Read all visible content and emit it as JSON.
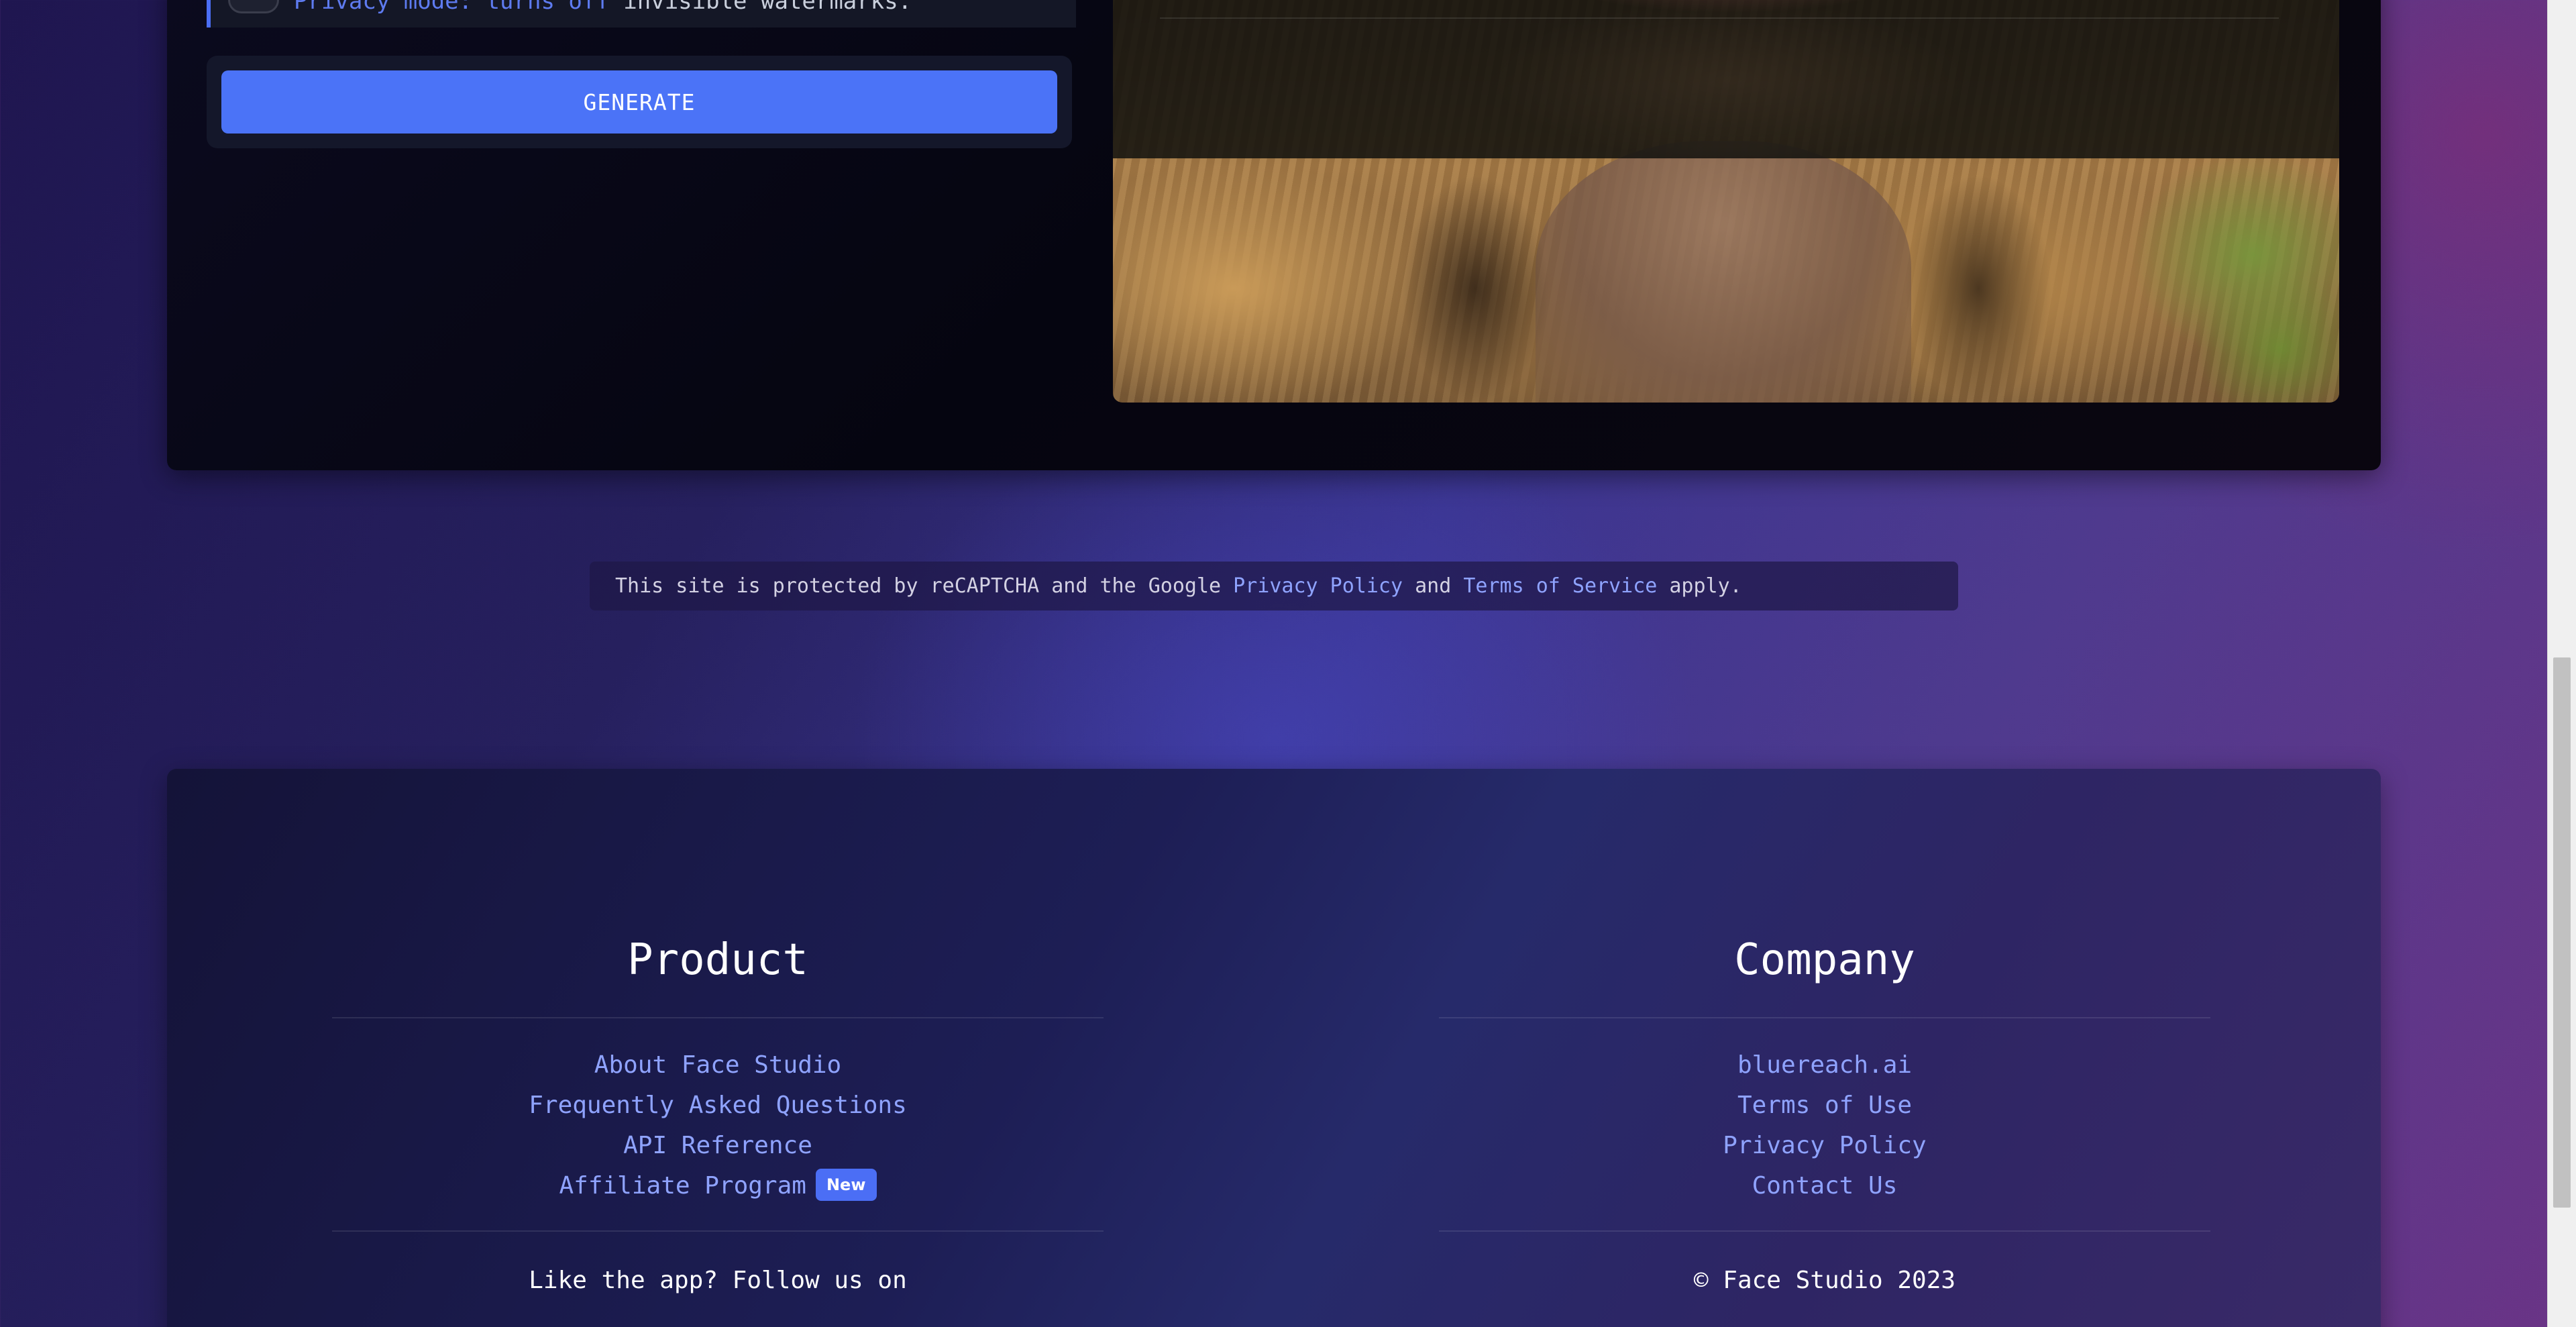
{
  "generator": {
    "toggle_prefix": "Privacy mode: turns off",
    "toggle_suffix": " invisible watermarks.",
    "generate_label": "GENERATE"
  },
  "recaptcha": {
    "text_before": "This site is protected by reCAPTCHA and the Google ",
    "privacy_link": "Privacy Policy",
    "text_mid": " and ",
    "terms_link": "Terms of Service",
    "text_after": " apply."
  },
  "footer": {
    "product": {
      "heading": "Product",
      "links": [
        "About Face Studio",
        "Frequently Asked Questions",
        "API Reference",
        "Affiliate Program"
      ],
      "badge": "New",
      "follow_text": "Like the app? Follow us on"
    },
    "company": {
      "heading": "Company",
      "links": [
        "bluereach.ai",
        "Terms of Use",
        "Privacy Policy",
        "Contact Us"
      ],
      "copyright": "© Face Studio 2023"
    }
  },
  "colors": {
    "accent": "#4b73f7",
    "link": "#8fa3ff"
  }
}
